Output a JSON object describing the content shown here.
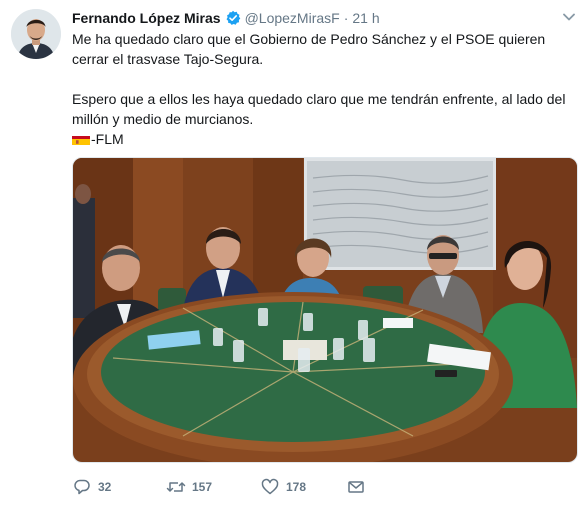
{
  "tweet": {
    "author_name": "Fernando López Miras",
    "handle": "@LopezMirasF",
    "separator": "·",
    "time": "21 h",
    "paragraph1": "Me ha quedado claro que el Gobierno de Pedro Sánchez y el PSOE quieren cerrar el trasvase Tajo-Segura.",
    "paragraph2": "Espero que a ellos les haya quedado claro que me tendrán enfrente, al lado del millón y medio de murcianos.",
    "signature": "-FLM",
    "flag_icon": "spain-flag-icon"
  },
  "actions": {
    "reply_count": "32",
    "retweet_count": "157",
    "like_count": "178"
  },
  "colors": {
    "text": "#14171a",
    "secondary": "#657786",
    "verified": "#1da1f2",
    "table_green": "#2f6b45",
    "table_wood": "#8a4a22"
  }
}
